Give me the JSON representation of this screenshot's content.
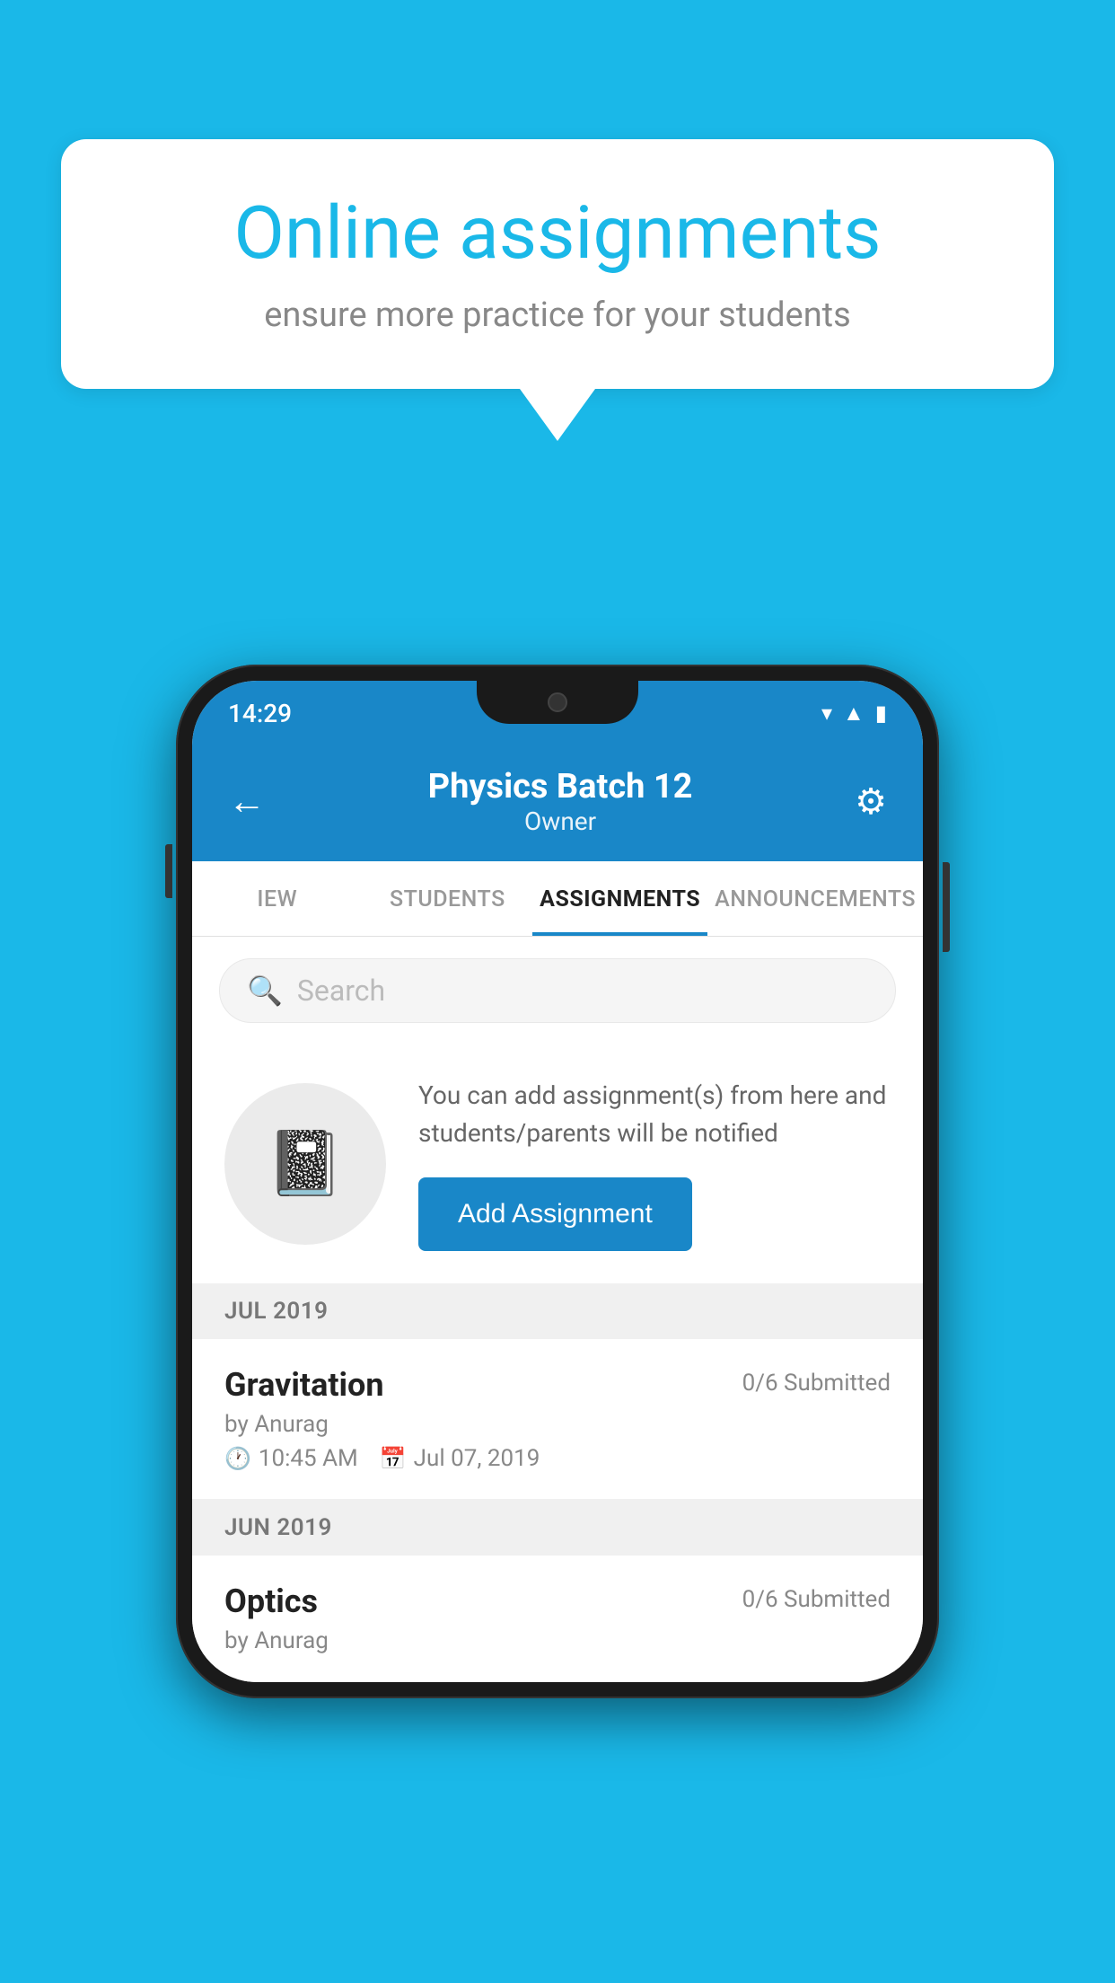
{
  "background_color": "#1ab8e8",
  "speech_bubble": {
    "title": "Online assignments",
    "subtitle": "ensure more practice for your students"
  },
  "phone": {
    "status_bar": {
      "time": "14:29",
      "icons": [
        "wifi",
        "signal",
        "battery"
      ]
    },
    "header": {
      "title": "Physics Batch 12",
      "subtitle": "Owner",
      "back_label": "←",
      "settings_label": "⚙"
    },
    "tabs": [
      {
        "label": "IEW",
        "active": false
      },
      {
        "label": "STUDENTS",
        "active": false
      },
      {
        "label": "ASSIGNMENTS",
        "active": true
      },
      {
        "label": "ANNOUNCEMENTS",
        "active": false
      }
    ],
    "search": {
      "placeholder": "Search"
    },
    "info_card": {
      "description": "You can add assignment(s) from here and students/parents will be notified",
      "add_button_label": "Add Assignment"
    },
    "sections": [
      {
        "label": "JUL 2019",
        "assignments": [
          {
            "name": "Gravitation",
            "submitted": "0/6 Submitted",
            "by": "by Anurag",
            "time": "10:45 AM",
            "date": "Jul 07, 2019"
          }
        ]
      },
      {
        "label": "JUN 2019",
        "assignments": [
          {
            "name": "Optics",
            "submitted": "0/6 Submitted",
            "by": "by Anurag",
            "time": "",
            "date": ""
          }
        ]
      }
    ]
  }
}
